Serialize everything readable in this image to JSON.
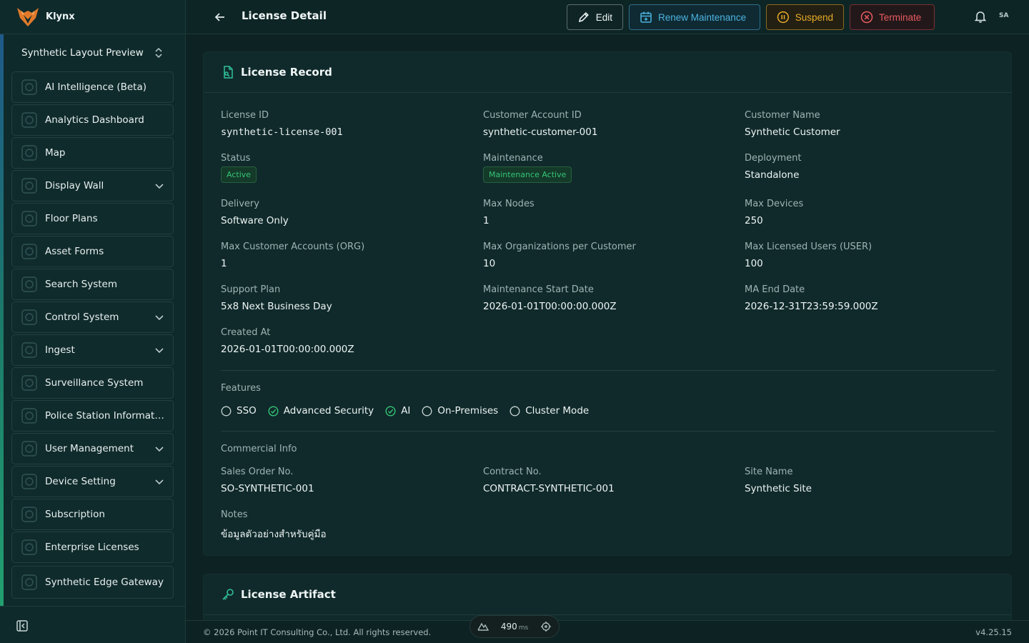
{
  "brand": {
    "name": "Klynx"
  },
  "sidebar": {
    "org": "Synthetic Layout Preview",
    "items": [
      {
        "label": "AI Intelligence (Beta)",
        "icon": "ai-icon",
        "expandable": false
      },
      {
        "label": "Analytics Dashboard",
        "icon": "analytics-icon",
        "expandable": false
      },
      {
        "label": "Map",
        "icon": "map-icon",
        "expandable": false
      },
      {
        "label": "Display Wall",
        "icon": "display-wall-icon",
        "expandable": true
      },
      {
        "label": "Floor Plans",
        "icon": "floor-plans-icon",
        "expandable": false
      },
      {
        "label": "Asset Forms",
        "icon": "asset-forms-icon",
        "expandable": false
      },
      {
        "label": "Search System",
        "icon": "search-system-icon",
        "expandable": false
      },
      {
        "label": "Control System",
        "icon": "control-system-icon",
        "expandable": true
      },
      {
        "label": "Ingest",
        "icon": "ingest-icon",
        "expandable": true
      },
      {
        "label": "Surveillance System",
        "icon": "surveillance-icon",
        "expandable": false
      },
      {
        "label": "Police Station Information",
        "icon": "police-station-icon",
        "expandable": false
      },
      {
        "label": "User Management",
        "icon": "user-management-icon",
        "expandable": true
      },
      {
        "label": "Device Setting",
        "icon": "device-setting-icon",
        "expandable": true
      },
      {
        "label": "Subscription",
        "icon": "subscription-icon",
        "expandable": false
      },
      {
        "label": "Enterprise Licenses",
        "icon": "enterprise-licenses-icon",
        "expandable": false
      },
      {
        "label": "Synthetic Edge Gateway",
        "icon": "edge-gateway-icon",
        "expandable": false
      }
    ]
  },
  "header": {
    "title": "License Detail",
    "edit_label": "Edit",
    "renew_label": "Renew Maintenance",
    "suspend_label": "Suspend",
    "terminate_label": "Terminate",
    "avatar_initials": "SA",
    "colors": {
      "renew": "#4cb4e0",
      "suspend": "#e9ad2a",
      "terminate": "#e85a5f"
    }
  },
  "record": {
    "title": "License Record",
    "fields": {
      "license_id": {
        "label": "License ID",
        "value": "synthetic-license-001"
      },
      "customer_account_id": {
        "label": "Customer Account ID",
        "value": "synthetic-customer-001"
      },
      "customer_name": {
        "label": "Customer Name",
        "value": "Synthetic Customer"
      },
      "status": {
        "label": "Status",
        "value": "Active"
      },
      "maintenance": {
        "label": "Maintenance",
        "value": "Maintenance Active"
      },
      "deployment": {
        "label": "Deployment",
        "value": "Standalone"
      },
      "delivery": {
        "label": "Delivery",
        "value": "Software Only"
      },
      "max_nodes": {
        "label": "Max Nodes",
        "value": "1"
      },
      "max_devices": {
        "label": "Max Devices",
        "value": "250"
      },
      "max_customer_accounts": {
        "label": "Max Customer Accounts (ORG)",
        "value": "1"
      },
      "max_orgs_per_customer": {
        "label": "Max Organizations per Customer",
        "value": "10"
      },
      "max_licensed_users": {
        "label": "Max Licensed Users (USER)",
        "value": "100"
      },
      "support_plan": {
        "label": "Support Plan",
        "value": "5x8 Next Business Day"
      },
      "maintenance_start": {
        "label": "Maintenance Start Date",
        "value": "2026-01-01T00:00:00.000Z"
      },
      "ma_end": {
        "label": "MA End Date",
        "value": "2026-12-31T23:59:59.000Z"
      },
      "created_at": {
        "label": "Created At",
        "value": "2026-01-01T00:00:00.000Z"
      }
    },
    "features_label": "Features",
    "features": [
      {
        "label": "SSO",
        "enabled": false
      },
      {
        "label": "Advanced Security",
        "enabled": true
      },
      {
        "label": "AI",
        "enabled": true
      },
      {
        "label": "On-Premises",
        "enabled": false
      },
      {
        "label": "Cluster Mode",
        "enabled": false
      }
    ],
    "commercial_label": "Commercial Info",
    "commercial": {
      "sales_order": {
        "label": "Sales Order No.",
        "value": "SO-SYNTHETIC-001"
      },
      "contract": {
        "label": "Contract No.",
        "value": "CONTRACT-SYNTHETIC-001"
      },
      "site_name": {
        "label": "Site Name",
        "value": "Synthetic Site"
      },
      "notes": {
        "label": "Notes",
        "value": "ข้อมูลตัวอย่างสำหรับคู่มือ"
      }
    }
  },
  "artifact": {
    "title": "License Artifact"
  },
  "footer": {
    "copyright": "© 2026 Point IT Consulting Co., Ltd. All rights reserved.",
    "version": "v4.25.15",
    "perf_value": "490",
    "perf_unit": "ms"
  }
}
